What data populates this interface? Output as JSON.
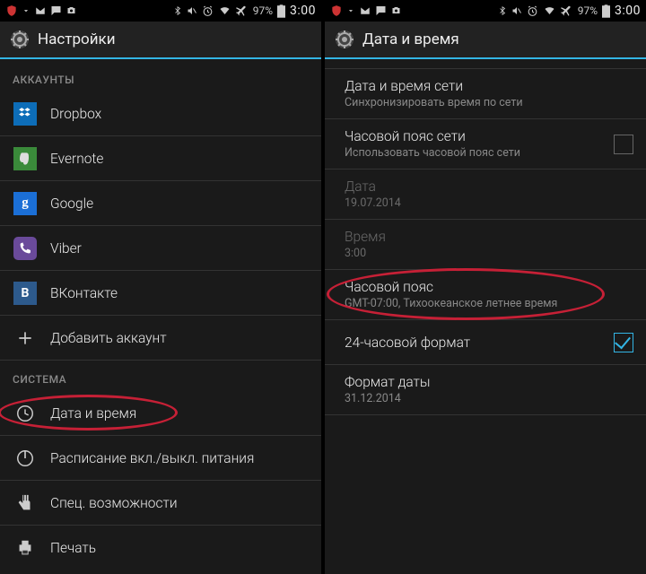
{
  "status": {
    "battery": "97%",
    "time": "3:00"
  },
  "left": {
    "title": "Настройки",
    "section_accounts": "АККАУНТЫ",
    "accounts": [
      {
        "label": "Dropbox"
      },
      {
        "label": "Evernote"
      },
      {
        "label": "Google"
      },
      {
        "label": "Viber"
      },
      {
        "label": "ВКонтакте"
      }
    ],
    "add_account": "Добавить аккаунт",
    "section_system": "СИСТЕМА",
    "system": [
      {
        "label": "Дата и время"
      },
      {
        "label": "Расписание вкл./выкл. питания"
      },
      {
        "label": "Спец. возможности"
      },
      {
        "label": "Печать"
      }
    ]
  },
  "right": {
    "title": "Дата и время",
    "items": [
      {
        "label": "Дата и время сети",
        "sub": "Синхронизировать время по сети"
      },
      {
        "label": "Часовой пояс сети",
        "sub": "Использовать часовой пояс сети"
      },
      {
        "label": "Дата",
        "sub": "19.07.2014"
      },
      {
        "label": "Время",
        "sub": "3:00"
      },
      {
        "label": "Часовой пояс",
        "sub": "GMT-07:00, Тихоокеанское летнее время"
      },
      {
        "label": "24-часовой формат",
        "sub": ""
      },
      {
        "label": "Формат даты",
        "sub": "31.12.2014"
      }
    ]
  }
}
